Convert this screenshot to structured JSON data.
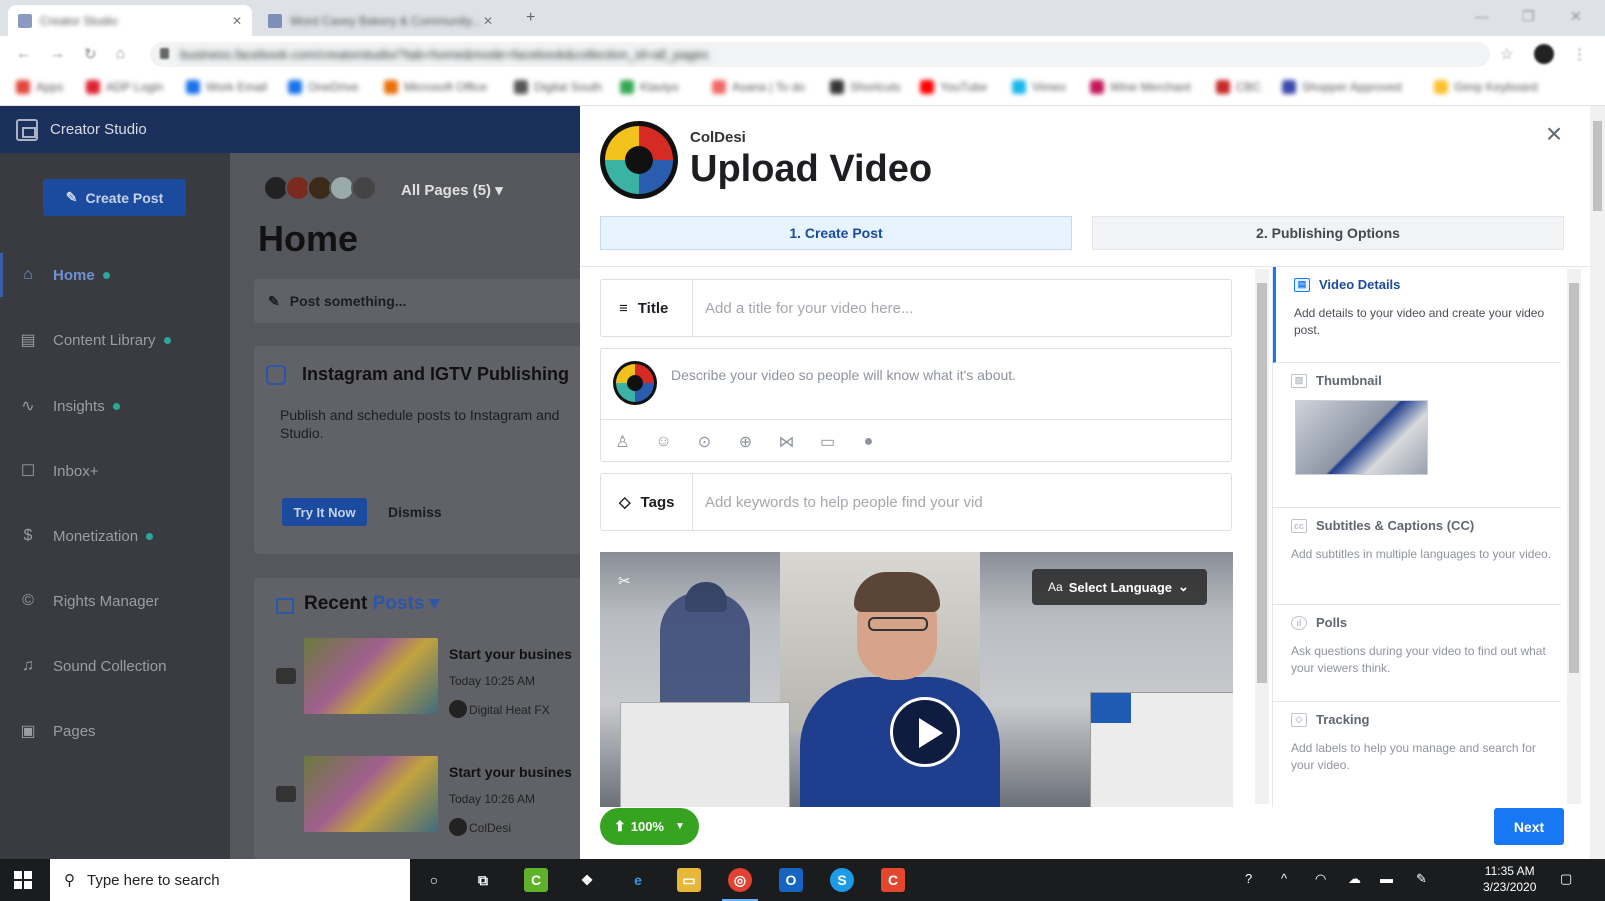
{
  "browser": {
    "tabs": [
      {
        "title": "Creator Studio"
      },
      {
        "title": "Word Cavey Bakery & Community..."
      }
    ],
    "url": "business.facebook.com/creatorstudio/?tab=home&mode=facebook&collection_id=all_pages",
    "bookmarks": [
      "Apps",
      "ADP Login",
      "Work Email",
      "OneDrive",
      "Microsoft Office",
      "Digital South",
      "Klaviyo",
      "Asana | To do",
      "Shortcuts",
      "YouTube",
      "Vimeo",
      "Wine Merchant",
      "CBC",
      "Shopper Approved",
      "Gimp Keyboard"
    ]
  },
  "sidebar": {
    "app_name": "Creator Studio",
    "create_post": "Create Post",
    "items": [
      {
        "label": "Home",
        "icon": "home-icon",
        "dot": true
      },
      {
        "label": "Content Library",
        "icon": "library-icon",
        "dot": true
      },
      {
        "label": "Insights",
        "icon": "insights-icon",
        "dot": true
      },
      {
        "label": "Inbox+",
        "icon": "inbox-icon",
        "dot": false
      },
      {
        "label": "Monetization",
        "icon": "dollar-icon",
        "dot": true
      },
      {
        "label": "Rights Manager",
        "icon": "copyright-icon",
        "dot": false
      },
      {
        "label": "Sound Collection",
        "icon": "sound-icon",
        "dot": false
      },
      {
        "label": "Pages",
        "icon": "pages-icon",
        "dot": false
      }
    ]
  },
  "main": {
    "all_pages": "All Pages (5)",
    "title": "Home",
    "post_something": "Post something...",
    "ig_card": {
      "title": "Instagram and IGTV Publishing",
      "body": "Publish and schedule posts to Instagram and Studio.",
      "try_label": "Try It Now",
      "dismiss_label": "Dismiss"
    },
    "recent": {
      "label": "Recent",
      "filter": "Posts",
      "posts": [
        {
          "title": "Start your busines",
          "time": "Today 10:25 AM",
          "author": "Digital Heat FX"
        },
        {
          "title": "Start your busines",
          "time": "Today 10:26 AM",
          "author": "ColDesi"
        }
      ]
    }
  },
  "modal": {
    "page_name": "ColDesi",
    "title": "Upload Video",
    "steps": [
      "1. Create Post",
      "2. Publishing Options"
    ],
    "title_field": {
      "label": "Title",
      "placeholder": "Add a title for your video here..."
    },
    "description_placeholder": "Describe your video so people will know what it's about.",
    "tags_field": {
      "label": "Tags",
      "placeholder": "Add keywords to help people find your vid"
    },
    "select_language": "Select Language",
    "select_language_prefix": "Aa",
    "upload_progress": "100%",
    "next_label": "Next",
    "right_panel": [
      {
        "title": "Video Details",
        "desc": "Add details to your video and create your video post."
      },
      {
        "title": "Thumbnail",
        "desc": ""
      },
      {
        "title": "Subtitles & Captions (CC)",
        "desc": "Add subtitles in multiple languages to your video."
      },
      {
        "title": "Polls",
        "desc": "Ask questions during your video to find out what your viewers think."
      },
      {
        "title": "Tracking",
        "desc": "Add labels to help you manage and search for your video."
      }
    ]
  },
  "taskbar": {
    "search_placeholder": "Type here to search",
    "time": "11:35 AM",
    "date": "3/23/2020"
  },
  "colors": {
    "accent": "#1877f2",
    "upload_green": "#36a420",
    "sidebar_header": "#1b315c"
  }
}
